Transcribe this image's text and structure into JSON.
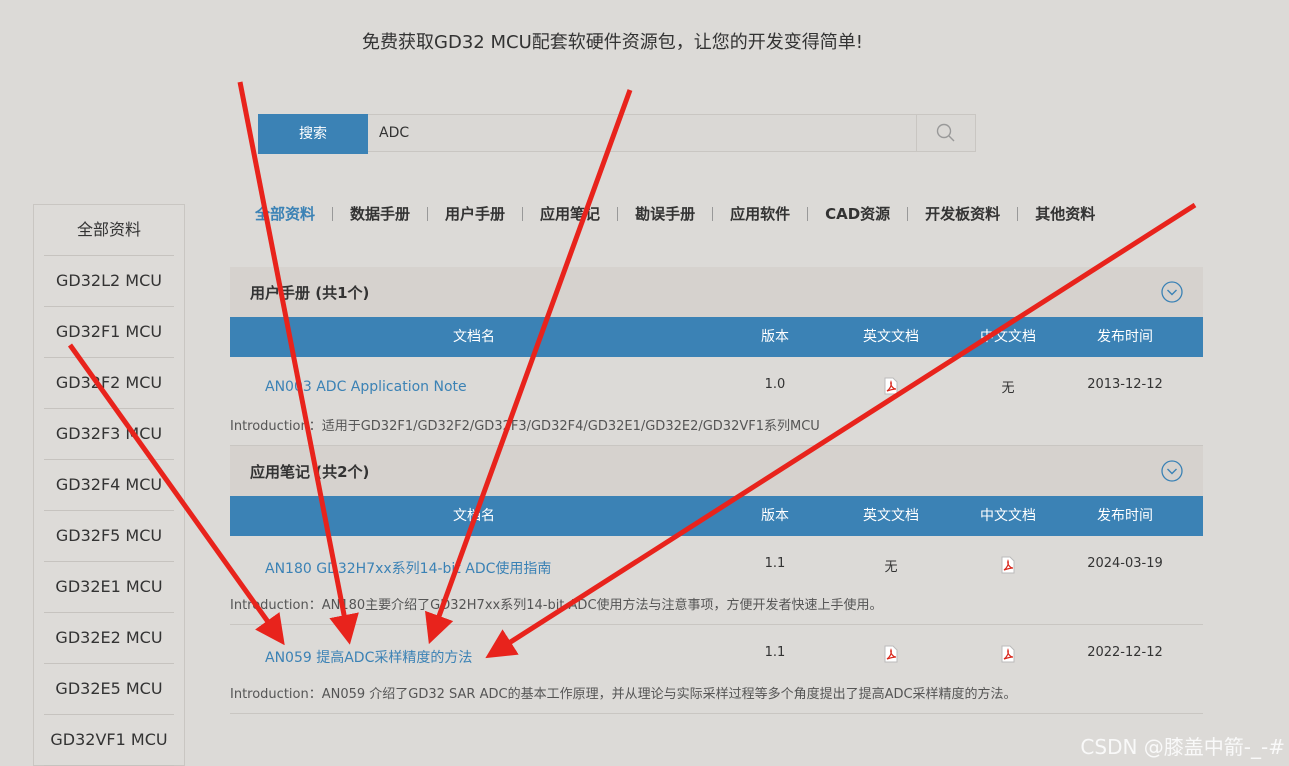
{
  "headline": "免费获取GD32 MCU配套软硬件资源包，让您的开发变得简单!",
  "search": {
    "button_label": "搜索",
    "value": "ADC"
  },
  "tabs": [
    "全部资料",
    "数据手册",
    "用户手册",
    "应用笔记",
    "勘误手册",
    "应用软件",
    "CAD资源",
    "开发板资料",
    "其他资料"
  ],
  "sidebar": [
    "全部资料",
    "GD32L2  MCU",
    "GD32F1  MCU",
    "GD32F2  MCU",
    "GD32F3  MCU",
    "GD32F4  MCU",
    "GD32F5  MCU",
    "GD32E1  MCU",
    "GD32E2  MCU",
    "GD32E5  MCU",
    "GD32VF1  MCU"
  ],
  "columns": [
    "文档名",
    "版本",
    "英文文档",
    "中文文档",
    "发布时间"
  ],
  "sections": [
    {
      "title": "用户手册 (共1个)",
      "rows": [
        {
          "name": "AN003 ADC Application Note",
          "version": "1.0",
          "en": "pdf",
          "cn": "无",
          "date": "2013-12-12",
          "intro": "Introduction：适用于GD32F1/GD32F2/GD32F3/GD32F4/GD32E1/GD32E2/GD32VF1系列MCU"
        }
      ]
    },
    {
      "title": "应用笔记 (共2个)",
      "rows": [
        {
          "name": "AN180 GD32H7xx系列14-bit ADC使用指南",
          "version": "1.1",
          "en": "无",
          "cn": "pdf",
          "date": "2024-03-19",
          "intro": "Introduction：AN180主要介绍了GD32H7xx系列14-bit ADC使用方法与注意事项，方便开发者快速上手使用。"
        },
        {
          "name": "AN059 提高ADC采样精度的方法",
          "version": "1.1",
          "en": "pdf",
          "cn": "pdf",
          "date": "2022-12-12",
          "intro": "Introduction：AN059 介绍了GD32 SAR ADC的基本工作原理，并从理论与实际采样过程等多个角度提出了提高ADC采样精度的方法。"
        }
      ]
    }
  ],
  "watermark": "CSDN @膝盖中箭-_-#",
  "colors": {
    "accent": "#3b82b5",
    "arrow": "#e8231c",
    "background": "#dcdad7"
  }
}
